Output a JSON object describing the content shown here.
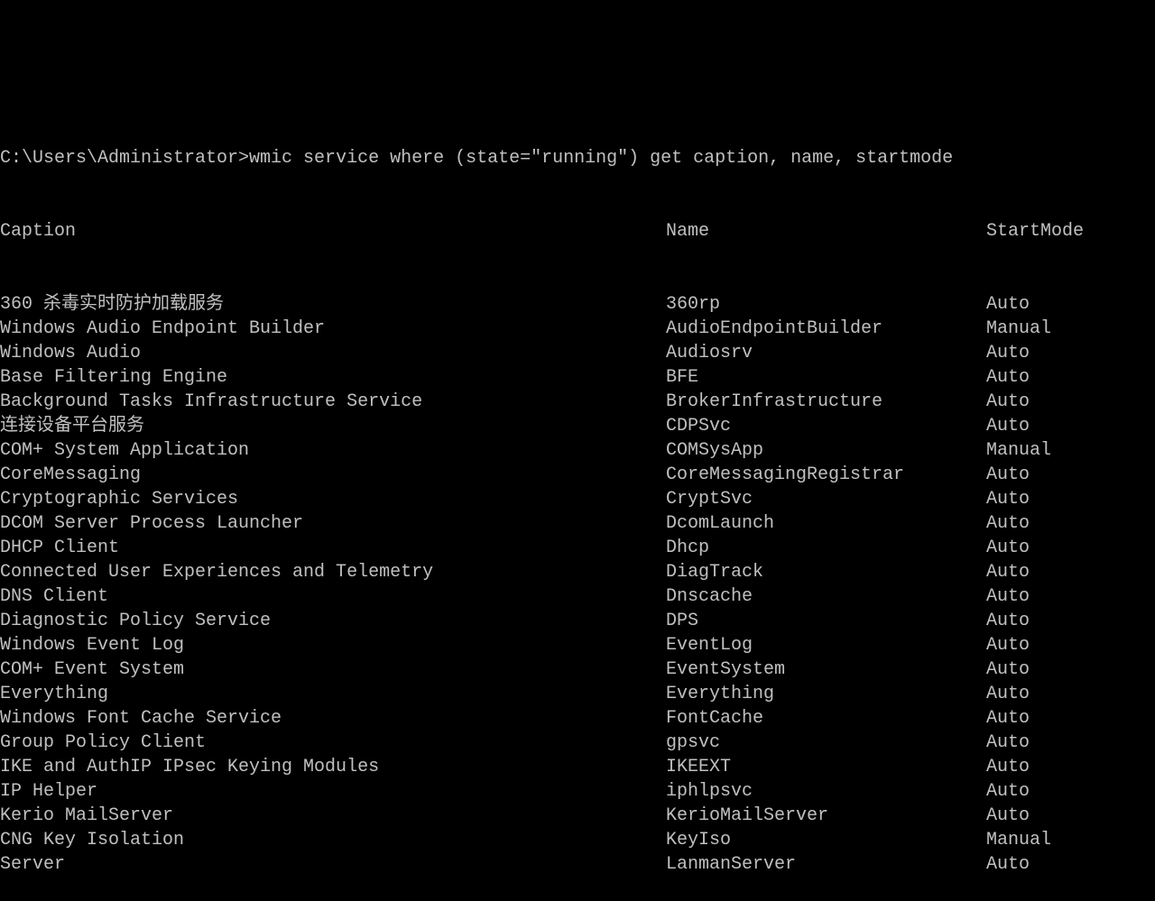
{
  "prompt": "C:\\Users\\Administrator>",
  "command": "wmic service where (state=\"running\") get caption, name, startmode",
  "headers": {
    "caption": "Caption",
    "name": "Name",
    "startmode": "StartMode"
  },
  "rows": [
    {
      "caption": "360 杀毒实时防护加载服务",
      "name": "360rp",
      "startmode": "Auto"
    },
    {
      "caption": "Windows Audio Endpoint Builder",
      "name": "AudioEndpointBuilder",
      "startmode": "Manual"
    },
    {
      "caption": "Windows Audio",
      "name": "Audiosrv",
      "startmode": "Auto"
    },
    {
      "caption": "Base Filtering Engine",
      "name": "BFE",
      "startmode": "Auto"
    },
    {
      "caption": "Background Tasks Infrastructure Service",
      "name": "BrokerInfrastructure",
      "startmode": "Auto"
    },
    {
      "caption": "连接设备平台服务",
      "name": "CDPSvc",
      "startmode": "Auto"
    },
    {
      "caption": "COM+ System Application",
      "name": "COMSysApp",
      "startmode": "Manual"
    },
    {
      "caption": "CoreMessaging",
      "name": "CoreMessagingRegistrar",
      "startmode": "Auto"
    },
    {
      "caption": "Cryptographic Services",
      "name": "CryptSvc",
      "startmode": "Auto"
    },
    {
      "caption": "DCOM Server Process Launcher",
      "name": "DcomLaunch",
      "startmode": "Auto"
    },
    {
      "caption": "DHCP Client",
      "name": "Dhcp",
      "startmode": "Auto"
    },
    {
      "caption": "Connected User Experiences and Telemetry",
      "name": "DiagTrack",
      "startmode": "Auto"
    },
    {
      "caption": "DNS Client",
      "name": "Dnscache",
      "startmode": "Auto"
    },
    {
      "caption": "Diagnostic Policy Service",
      "name": "DPS",
      "startmode": "Auto"
    },
    {
      "caption": "Windows Event Log",
      "name": "EventLog",
      "startmode": "Auto"
    },
    {
      "caption": "COM+ Event System",
      "name": "EventSystem",
      "startmode": "Auto"
    },
    {
      "caption": "Everything",
      "name": "Everything",
      "startmode": "Auto"
    },
    {
      "caption": "Windows Font Cache Service",
      "name": "FontCache",
      "startmode": "Auto"
    },
    {
      "caption": "Group Policy Client",
      "name": "gpsvc",
      "startmode": "Auto"
    },
    {
      "caption": "IKE and AuthIP IPsec Keying Modules",
      "name": "IKEEXT",
      "startmode": "Auto"
    },
    {
      "caption": "IP Helper",
      "name": "iphlpsvc",
      "startmode": "Auto"
    },
    {
      "caption": "Kerio MailServer",
      "name": "KerioMailServer",
      "startmode": "Auto"
    },
    {
      "caption": "CNG Key Isolation",
      "name": "KeyIso",
      "startmode": "Manual"
    },
    {
      "caption": "Server",
      "name": "LanmanServer",
      "startmode": "Auto"
    }
  ]
}
